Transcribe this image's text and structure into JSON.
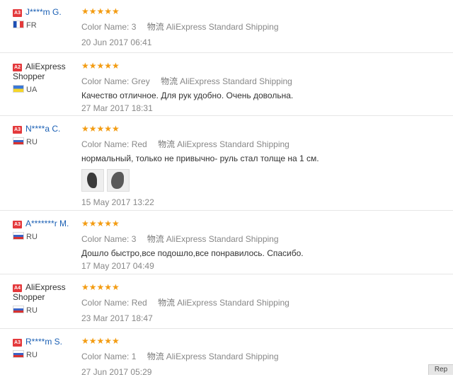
{
  "label_color_name": "Color Name:",
  "ship_icon": "物流",
  "reviews": [
    {
      "level": "A3",
      "name": "J****m G.",
      "country": "FR",
      "flag": "fr-flag-icon",
      "color": "3",
      "shipping": "AliExpress Standard Shipping",
      "feedback": "",
      "date": "20 Jun 2017 06:41",
      "stars": "★★★★★"
    },
    {
      "level": "A2",
      "name": "AliExpress Shopper",
      "country": "UA",
      "flag": "ua-flag-icon",
      "color": "Grey",
      "shipping": "AliExpress Standard Shipping",
      "feedback": "Качество отличное. Для рук удобно. Очень довольна.",
      "date": "27 Mar 2017 18:31",
      "stars": "★★★★★"
    },
    {
      "level": "A3",
      "name": "N****a C.",
      "country": "RU",
      "flag": "ru-flag-icon",
      "color": "Red",
      "shipping": "AliExpress Standard Shipping",
      "feedback": "нормальный, только не привычно- руль стал толще на 1 см.",
      "date": "15 May 2017 13:22",
      "stars": "★★★★★"
    },
    {
      "level": "A3",
      "name": "A*******r M.",
      "country": "RU",
      "flag": "ru-flag-icon",
      "color": "3",
      "shipping": "AliExpress Standard Shipping",
      "feedback": "Дошло быстро,все подошло,все понравилось. Спасибо.",
      "date": "17 May 2017 04:49",
      "stars": "★★★★★"
    },
    {
      "level": "A4",
      "name": "AliExpress Shopper",
      "country": "RU",
      "flag": "ru-flag-icon",
      "color": "Red",
      "shipping": "AliExpress Standard Shipping",
      "feedback": "",
      "date": "23 Mar 2017 18:47",
      "stars": "★★★★★"
    },
    {
      "level": "A3",
      "name": "R****m S.",
      "country": "RU",
      "flag": "ru-flag-icon",
      "color": "1",
      "shipping": "AliExpress Standard Shipping",
      "feedback": "",
      "date": "27 Jun 2017 05:29",
      "stars": "★★★★★"
    }
  ],
  "corner_button": "Rep"
}
